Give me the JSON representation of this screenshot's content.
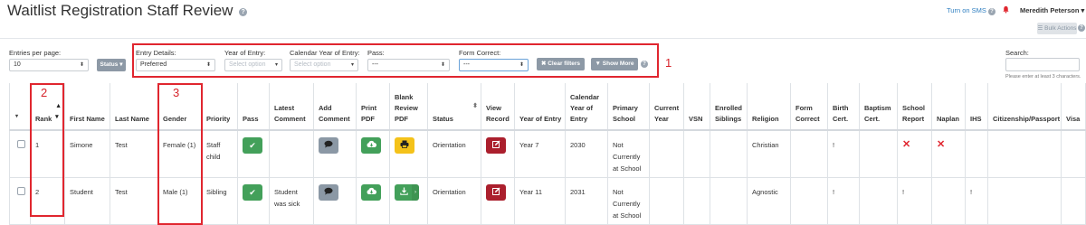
{
  "header": {
    "title": "Waitlist Registration Staff Review",
    "sms_link": "Turn on SMS",
    "user_name": "Meredith Peterson",
    "bulk_actions": "Bulk Actions"
  },
  "controls": {
    "entries_label": "Entries per page:",
    "entries_value": "10",
    "status_button": "Status",
    "entry_details_label": "Entry Details:",
    "entry_details_value": "Preferred",
    "year_of_entry_label": "Year of Entry:",
    "year_of_entry_placeholder": "Select option",
    "calendar_year_label": "Calendar Year of Entry:",
    "calendar_year_placeholder": "Select option",
    "pass_label": "Pass:",
    "pass_value": "---",
    "form_correct_label": "Form Correct:",
    "form_correct_value": "---",
    "clear_filters": "Clear filters",
    "show_more": "Show More",
    "search_label": "Search:",
    "search_hint": "Please enter at least 3 characters."
  },
  "annotations": [
    "1",
    "2",
    "3"
  ],
  "table": {
    "headers": [
      "",
      "Rank",
      "First Name",
      "Last Name",
      "Gender",
      "Priority",
      "Pass",
      "Latest Comment",
      "Add Comment",
      "Print PDF",
      "Blank Review PDF",
      "Status",
      "View Record",
      "Year of Entry",
      "Calendar Year of Entry",
      "Primary School",
      "Current Year",
      "VSN",
      "Enrolled Siblings",
      "Religion",
      "Form Correct",
      "Birth Cert.",
      "Baptism Cert.",
      "School Report",
      "Naplan",
      "IHS",
      "Citizenship/Passport",
      "Visa"
    ],
    "rows": [
      {
        "rank": "1",
        "first_name": "Simone",
        "last_name": "Test",
        "gender": "Female (1)",
        "priority": "Staff child",
        "latest_comment": "",
        "status": "Orientation",
        "year_of_entry": "Year 7",
        "calendar_year": "2030",
        "primary_school": "Not Currently at School",
        "current_year": "",
        "vsn": "",
        "enrolled_siblings": "",
        "religion": "Christian",
        "form_correct": "",
        "birth_cert": "!",
        "baptism_cert": "",
        "school_report": "✕",
        "naplan": "✕",
        "ihs": "",
        "citizenship": "",
        "visa": ""
      },
      {
        "rank": "2",
        "first_name": "Student",
        "last_name": "Test",
        "gender": "Male (1)",
        "priority": "Sibling",
        "latest_comment": "Student was sick",
        "status": "Orientation",
        "year_of_entry": "Year 11",
        "calendar_year": "2031",
        "primary_school": "Not Currently at School",
        "current_year": "",
        "vsn": "",
        "enrolled_siblings": "",
        "religion": "Agnostic",
        "form_correct": "",
        "birth_cert": "!",
        "baptism_cert": "",
        "school_report": "!",
        "naplan": "",
        "ihs": "!",
        "citizenship": "",
        "visa": ""
      }
    ]
  },
  "colors": {
    "pass_green": "#43a05a",
    "comment_gray": "#8b98a5",
    "print_yellow": "#f4c21a",
    "view_red": "#ab1f2d",
    "annotation_red": "#e0262f",
    "link_blue": "#2f7fc1"
  },
  "icons": [
    "help-icon",
    "bell-icon",
    "check-icon",
    "comment-icon",
    "cloud-download-icon",
    "printer-icon",
    "download-icon",
    "edit-icon",
    "x-icon",
    "filter-icon"
  ]
}
